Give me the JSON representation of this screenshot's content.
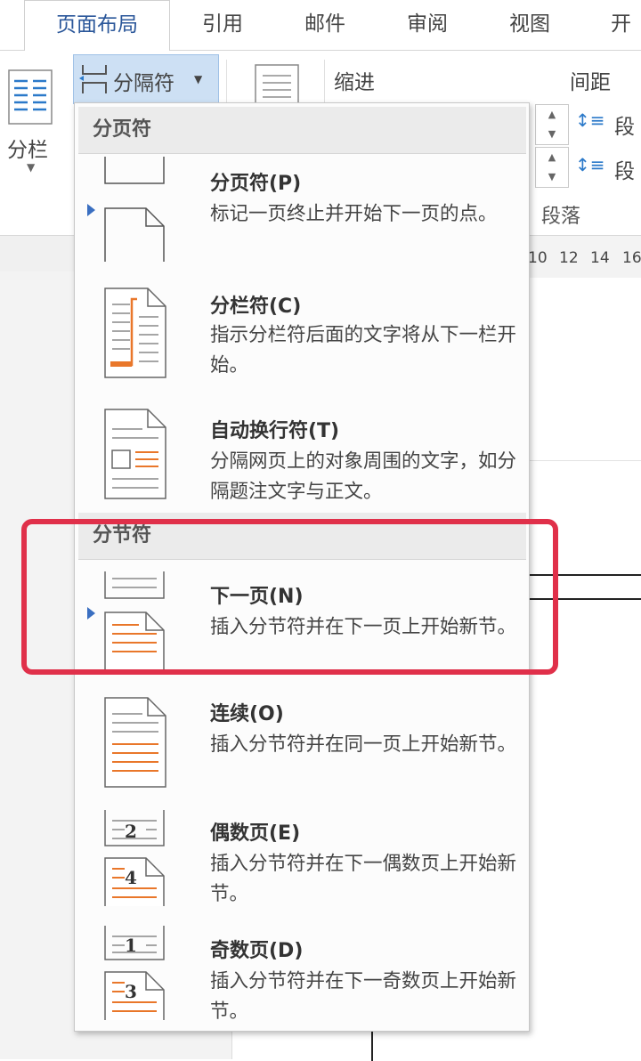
{
  "tabs": [
    "页面布局",
    "引用",
    "邮件",
    "审阅",
    "视图",
    "开"
  ],
  "ribbon": {
    "columns_label": "分栏",
    "breaks_label": "分隔符",
    "indent_label": "缩进",
    "spacing_label": "间距",
    "paragraph_label": "段落",
    "spacing_before_label": "段",
    "spacing_after_label": "段",
    "ruler_numbers": [
      "10",
      "12",
      "14",
      "16"
    ]
  },
  "menu": {
    "page_breaks_header": "分页符",
    "section_breaks_header": "分节符",
    "items": [
      {
        "title": "分页符(P)",
        "desc": "标记一页终止并开始下一页的点。"
      },
      {
        "title": "分栏符(C)",
        "desc": "指示分栏符后面的文字将从下一栏开始。"
      },
      {
        "title": "自动换行符(T)",
        "desc": "分隔网页上的对象周围的文字，如分隔题注文字与正文。"
      },
      {
        "title": "下一页(N)",
        "desc": "插入分节符并在下一页上开始新节。"
      },
      {
        "title": "连续(O)",
        "desc": "插入分节符并在同一页上开始新节。"
      },
      {
        "title": "偶数页(E)",
        "desc": "插入分节符并在下一偶数页上开始新节。"
      },
      {
        "title": "奇数页(D)",
        "desc": "插入分节符并在下一奇数页上开始新节。"
      }
    ],
    "icon_numbers": {
      "even_top": "2",
      "even_bottom": "4",
      "odd_top": "1",
      "odd_bottom": "3"
    }
  },
  "colors": {
    "accent_blue": "#2b579a",
    "icon_orange": "#e9772a",
    "highlight_red": "#e0304a"
  }
}
